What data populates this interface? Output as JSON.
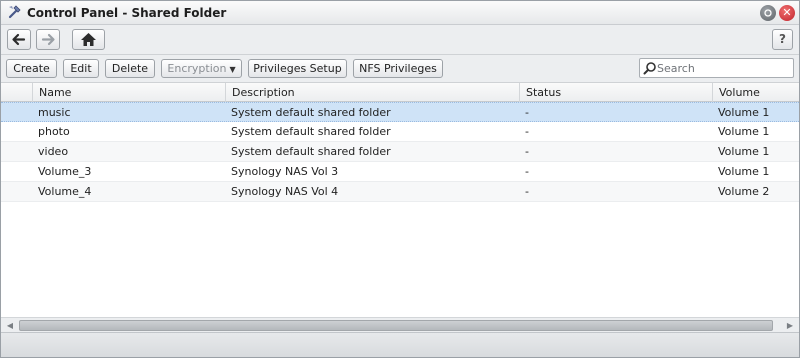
{
  "window": {
    "title": "Control Panel - Shared Folder",
    "icon": "control-panel-icon",
    "controls": {
      "minimize": "minimize-icon",
      "close": "close-icon",
      "close_glyph": "✕"
    }
  },
  "nav": {
    "back_glyph": "🡐",
    "forward_glyph": "🡒",
    "home_glyph": "⌂",
    "help_label": "?"
  },
  "toolbar": {
    "create": "Create",
    "edit": "Edit",
    "delete": "Delete",
    "encryption": "Encryption",
    "encryption_caret": "▼",
    "privileges_setup": "Privileges Setup",
    "nfs_privileges": "NFS Privileges"
  },
  "search": {
    "placeholder": "Search",
    "value": ""
  },
  "table": {
    "columns": [
      "Name",
      "Description",
      "Status",
      "Volume"
    ],
    "rows": [
      {
        "name": "music",
        "description": "System default shared folder",
        "status": "-",
        "volume": "Volume 1",
        "selected": true
      },
      {
        "name": "photo",
        "description": "System default shared folder",
        "status": "-",
        "volume": "Volume 1"
      },
      {
        "name": "video",
        "description": "System default shared folder",
        "status": "-",
        "volume": "Volume 1"
      },
      {
        "name": "Volume_3",
        "description": "Synology NAS Vol 3",
        "status": "-",
        "volume": "Volume 1"
      },
      {
        "name": "Volume_4",
        "description": "Synology NAS Vol 4",
        "status": "-",
        "volume": "Volume 2"
      }
    ]
  },
  "scrollbar": {
    "left_glyph": "◀",
    "right_glyph": "▶"
  },
  "colors": {
    "selected_row": "#cfe3f7",
    "close_button": "#c0232c"
  }
}
